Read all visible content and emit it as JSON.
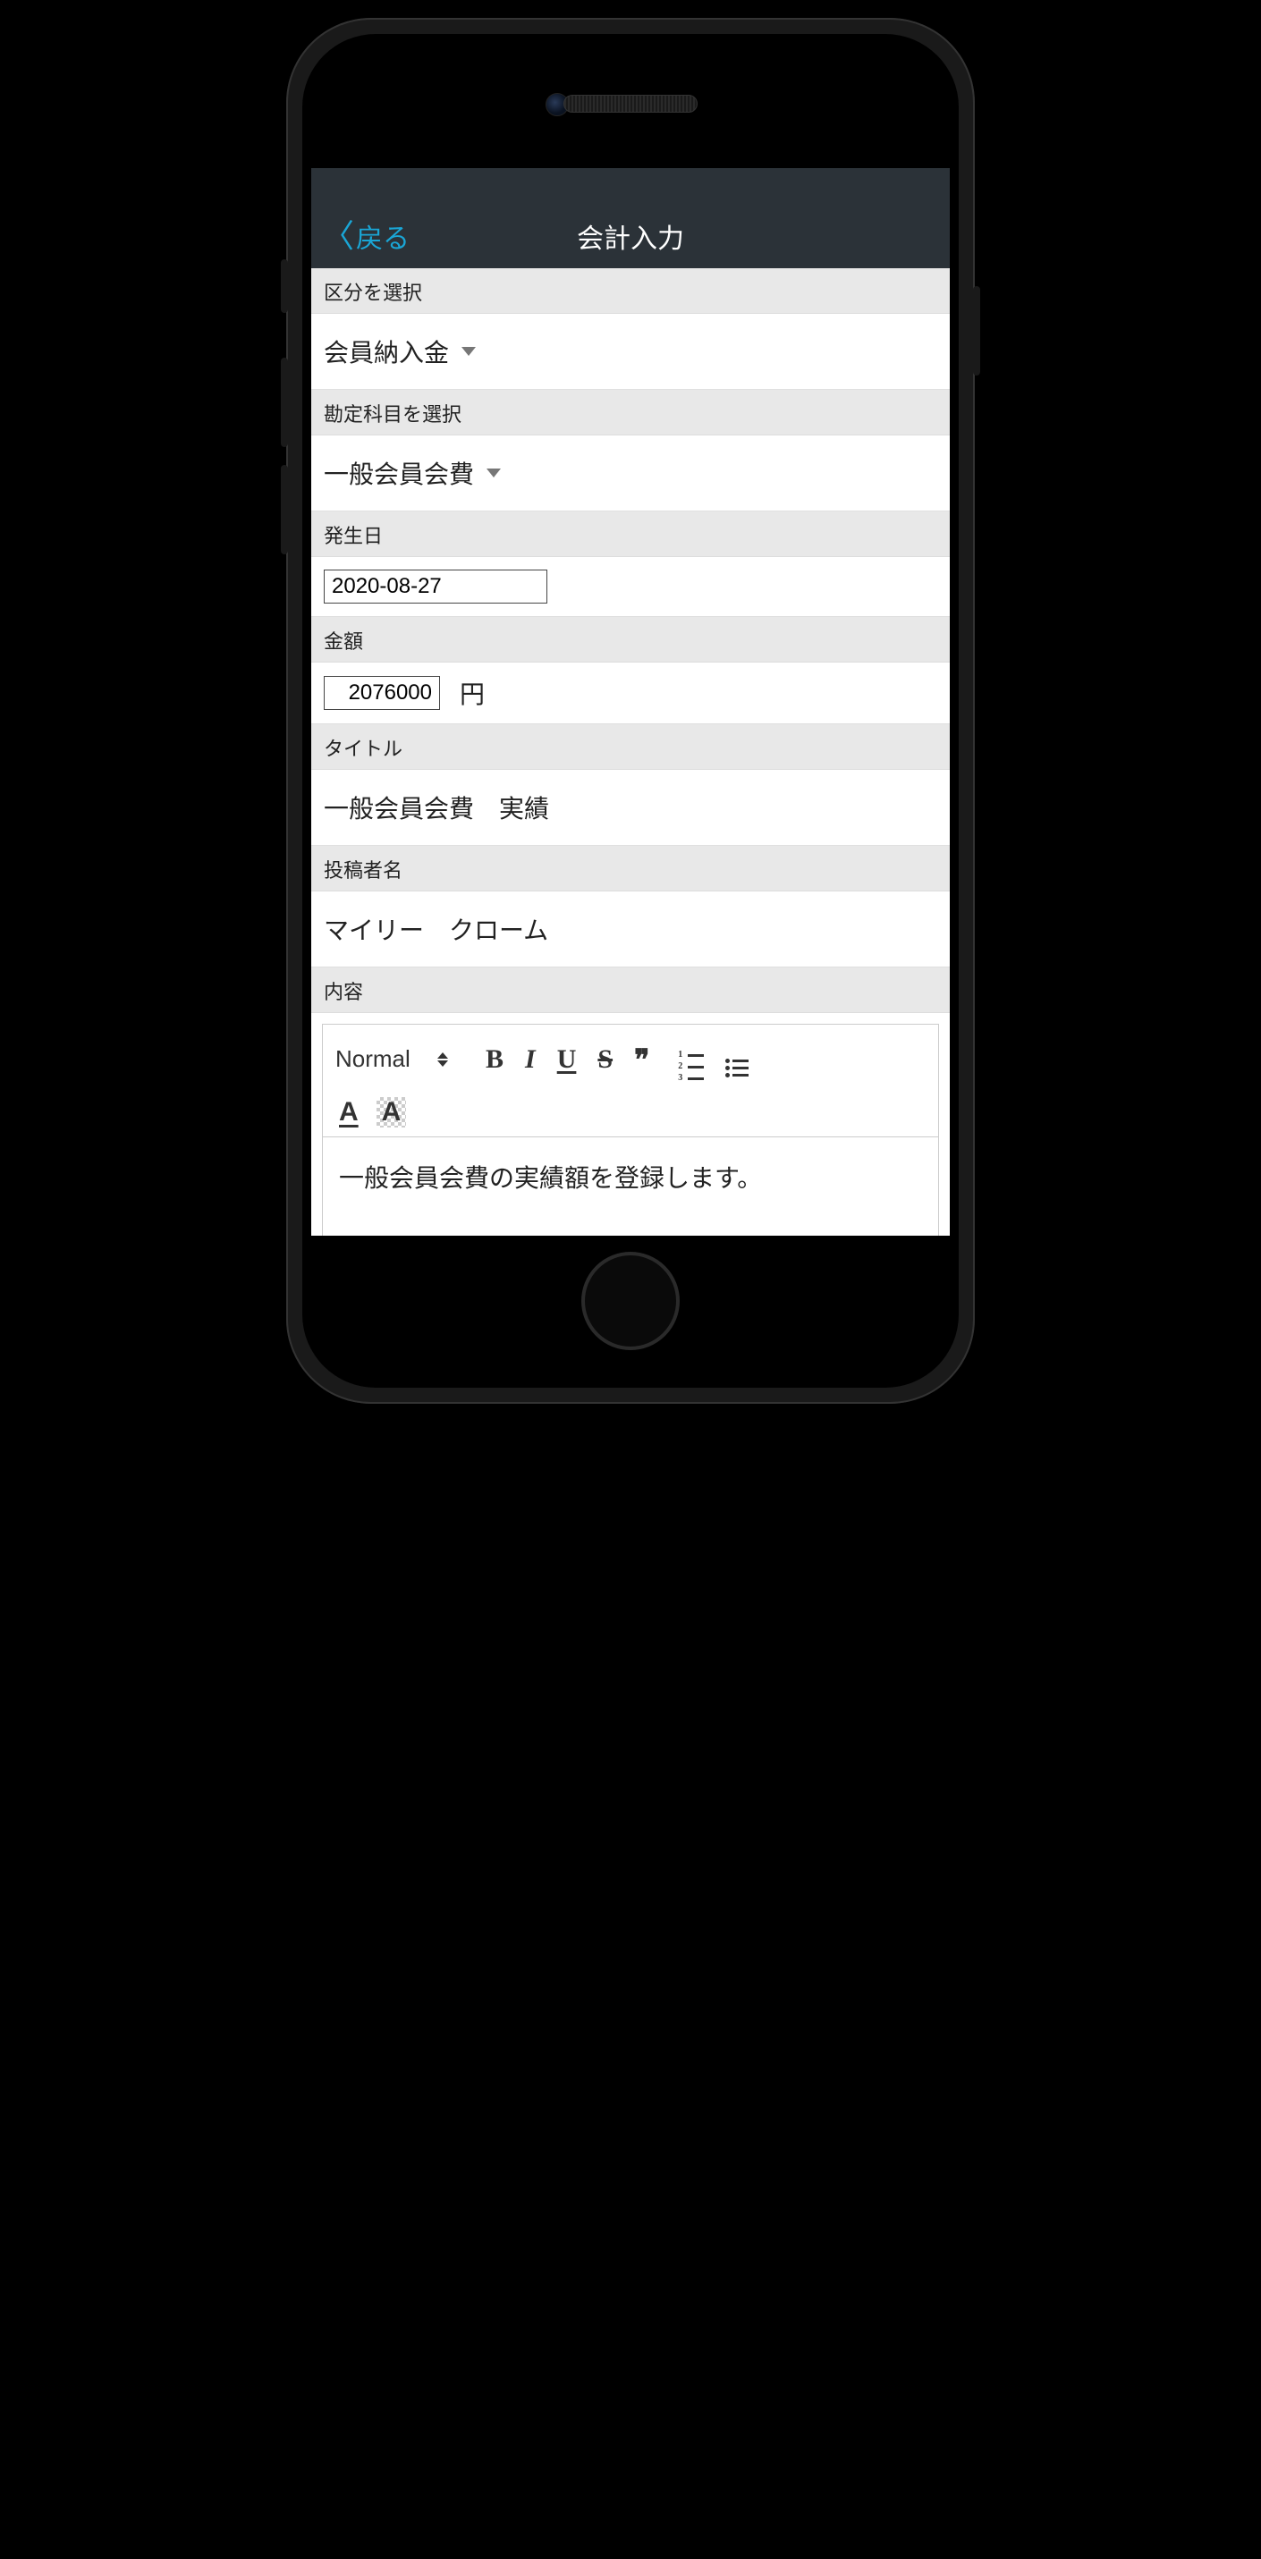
{
  "nav": {
    "back_label": "戻る",
    "title": "会計入力"
  },
  "sections": {
    "category_header": "区分を選択",
    "category_value": "会員納入金",
    "account_header": "勘定科目を選択",
    "account_value": "一般会員会費",
    "date_header": "発生日",
    "date_value": "2020-08-27",
    "amount_header": "金額",
    "amount_value": "2076000",
    "amount_unit": "円",
    "title_header": "タイトル",
    "title_value": "一般会員会費　実績",
    "author_header": "投稿者名",
    "author_value": "マイリー　クローム",
    "content_header": "内容"
  },
  "editor": {
    "style_select": "Normal",
    "body": "一般会員会費の実績額を登録します。"
  }
}
